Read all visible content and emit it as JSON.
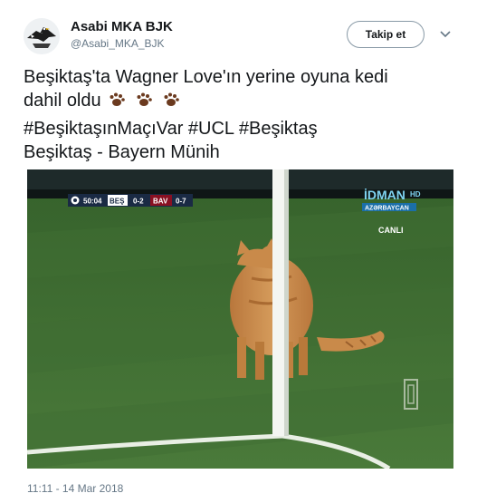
{
  "user": {
    "display_name": "Asabi MKA BJK",
    "handle": "@Asabi_MKA_BJK",
    "avatar_icon": "eagle-avatar-icon"
  },
  "actions": {
    "follow_label": "Takip et",
    "more_icon": "chevron-down-icon"
  },
  "tweet": {
    "line1": "Beşiktaş'ta Wagner Love'ın yerine oyuna kedi",
    "line2": "dahil oldu",
    "line3": "#BeşiktaşınMaçıVar #UCL #Beşiktaş",
    "line4": "Beşiktaş - Bayern Münih",
    "emoji_icons": [
      "paw-prints-icon",
      "paw-prints-icon",
      "paw-prints-icon"
    ]
  },
  "media": {
    "scoreboard": {
      "clock": "50:04",
      "home": "BEŞ",
      "score": "0-2",
      "away": "BAV",
      "aggregate": "0-7"
    },
    "channel": {
      "name": "İDMAN",
      "hd": "HD",
      "sub": "AZƏRBAYCAN",
      "live": "CANLI"
    }
  },
  "timestamp": "11:11 - 14 Mar 2018",
  "colors": {
    "text": "#14171a",
    "muted": "#657786",
    "pitch": "#3e6b31",
    "cat": "#c98a4a"
  }
}
